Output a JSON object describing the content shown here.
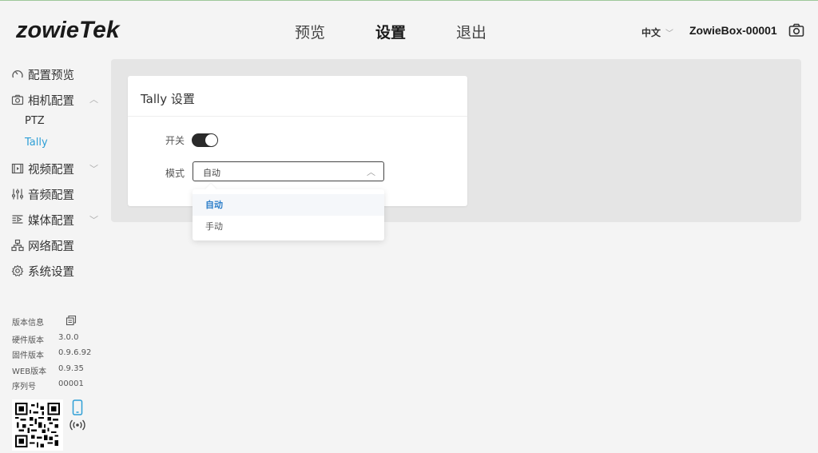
{
  "header": {
    "logo_a": "z",
    "logo_b": "owie",
    "logo_c": "Tek",
    "nav": [
      "预览",
      "设置",
      "退出"
    ],
    "nav_active_index": 1,
    "language": "中文",
    "device_name": "ZowieBox-00001"
  },
  "sidebar": {
    "items": [
      {
        "label": "配置预览",
        "icon": "gauge-icon"
      },
      {
        "label": "相机配置",
        "icon": "camera-icon",
        "expanded": true
      },
      {
        "label": "视频配置",
        "icon": "film-icon"
      },
      {
        "label": "音频配置",
        "icon": "sliders-icon"
      },
      {
        "label": "媒体配置",
        "icon": "media-icon"
      },
      {
        "label": "网络配置",
        "icon": "network-icon"
      },
      {
        "label": "系统设置",
        "icon": "gear-icon"
      }
    ],
    "sub_items": [
      "PTZ",
      "Tally"
    ],
    "active_sub": "Tally"
  },
  "version": {
    "title": "版本信息",
    "rows": [
      {
        "label": "硬件版本",
        "value": "3.0.0"
      },
      {
        "label": "固件版本",
        "value": "0.9.6.92"
      },
      {
        "label": "WEB版本",
        "value": "0.9.35"
      },
      {
        "label": "序列号",
        "value": "00001"
      }
    ]
  },
  "card": {
    "title": "Tally 设置",
    "switch_label": "开关",
    "switch_on": true,
    "mode_label": "模式",
    "mode_value": "自动"
  },
  "dropdown": {
    "options": [
      "自动",
      "手动"
    ],
    "selected": "自动"
  },
  "colors": {
    "accent": "#2e9fd6",
    "selected_option": "#2e7fc9",
    "panel_bg": "#e5e5e5",
    "page_bg": "#f4f4f4"
  }
}
